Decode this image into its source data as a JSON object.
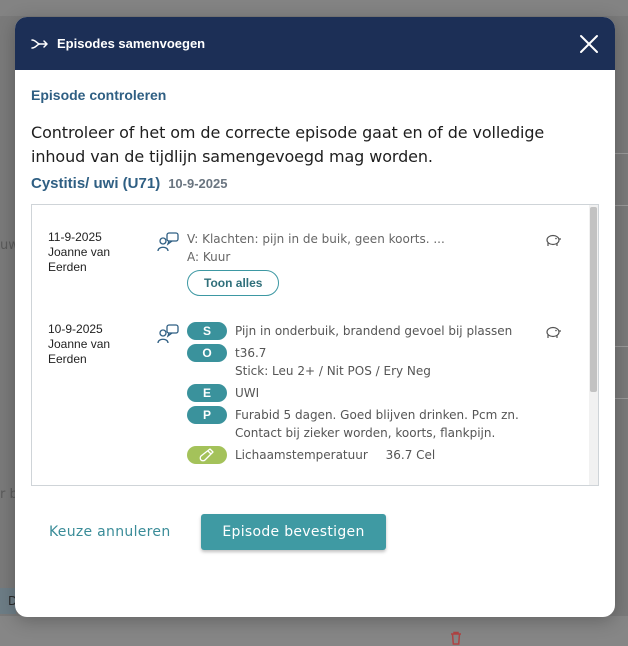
{
  "background": {
    "left_fragment_1": "uw",
    "left_fragment_2": "r b",
    "left_fragment_3": "D"
  },
  "modal": {
    "title": "Episodes samenvoegen",
    "icons": {
      "merge": "merge-arrow-icon",
      "close": "close-icon"
    },
    "section_title": "Episode controleren",
    "intro": "Controleer of het om de correcte episode gaat en of de volledige inhoud van de tijdlijn samengevoegd mag worden.",
    "episode": {
      "name": "Cystitis/ uwi (U71)",
      "date": "10-9-2025"
    }
  },
  "timeline": {
    "entries": [
      {
        "date": "11-9-2025",
        "author": "Joanne van Eerden",
        "lines": [
          "V: Klachten: pijn in de buik, geen koorts. ...",
          "A: Kuur"
        ],
        "show_all_label": "Toon alles"
      },
      {
        "date": "10-9-2025",
        "author": "Joanne van Eerden",
        "soep": [
          {
            "badge": "S",
            "lines": [
              "Pijn in onderbuik, brandend gevoel bij plassen"
            ]
          },
          {
            "badge": "O",
            "lines": [
              "t36.7",
              "Stick: Leu 2+ / Nit POS / Ery Neg"
            ]
          },
          {
            "badge": "E",
            "lines": [
              "UWI"
            ]
          },
          {
            "badge": "P",
            "lines": [
              "Furabid 5 dagen. Goed blijven drinken. Pcm zn.",
              "Contact bij zieker worden, koorts, flankpijn."
            ]
          }
        ],
        "measurement": {
          "label": "Lichaamstemperatuur",
          "value": "36.7 Cel"
        }
      }
    ]
  },
  "footer": {
    "cancel_label": "Keuze annuleren",
    "confirm_label": "Episode bevestigen"
  },
  "colors": {
    "header_bg": "#1c2f56",
    "accent": "#3f9aa3",
    "badge": "#3a929c",
    "measurement_badge": "#a4c25a",
    "title": "#2f5f83"
  }
}
